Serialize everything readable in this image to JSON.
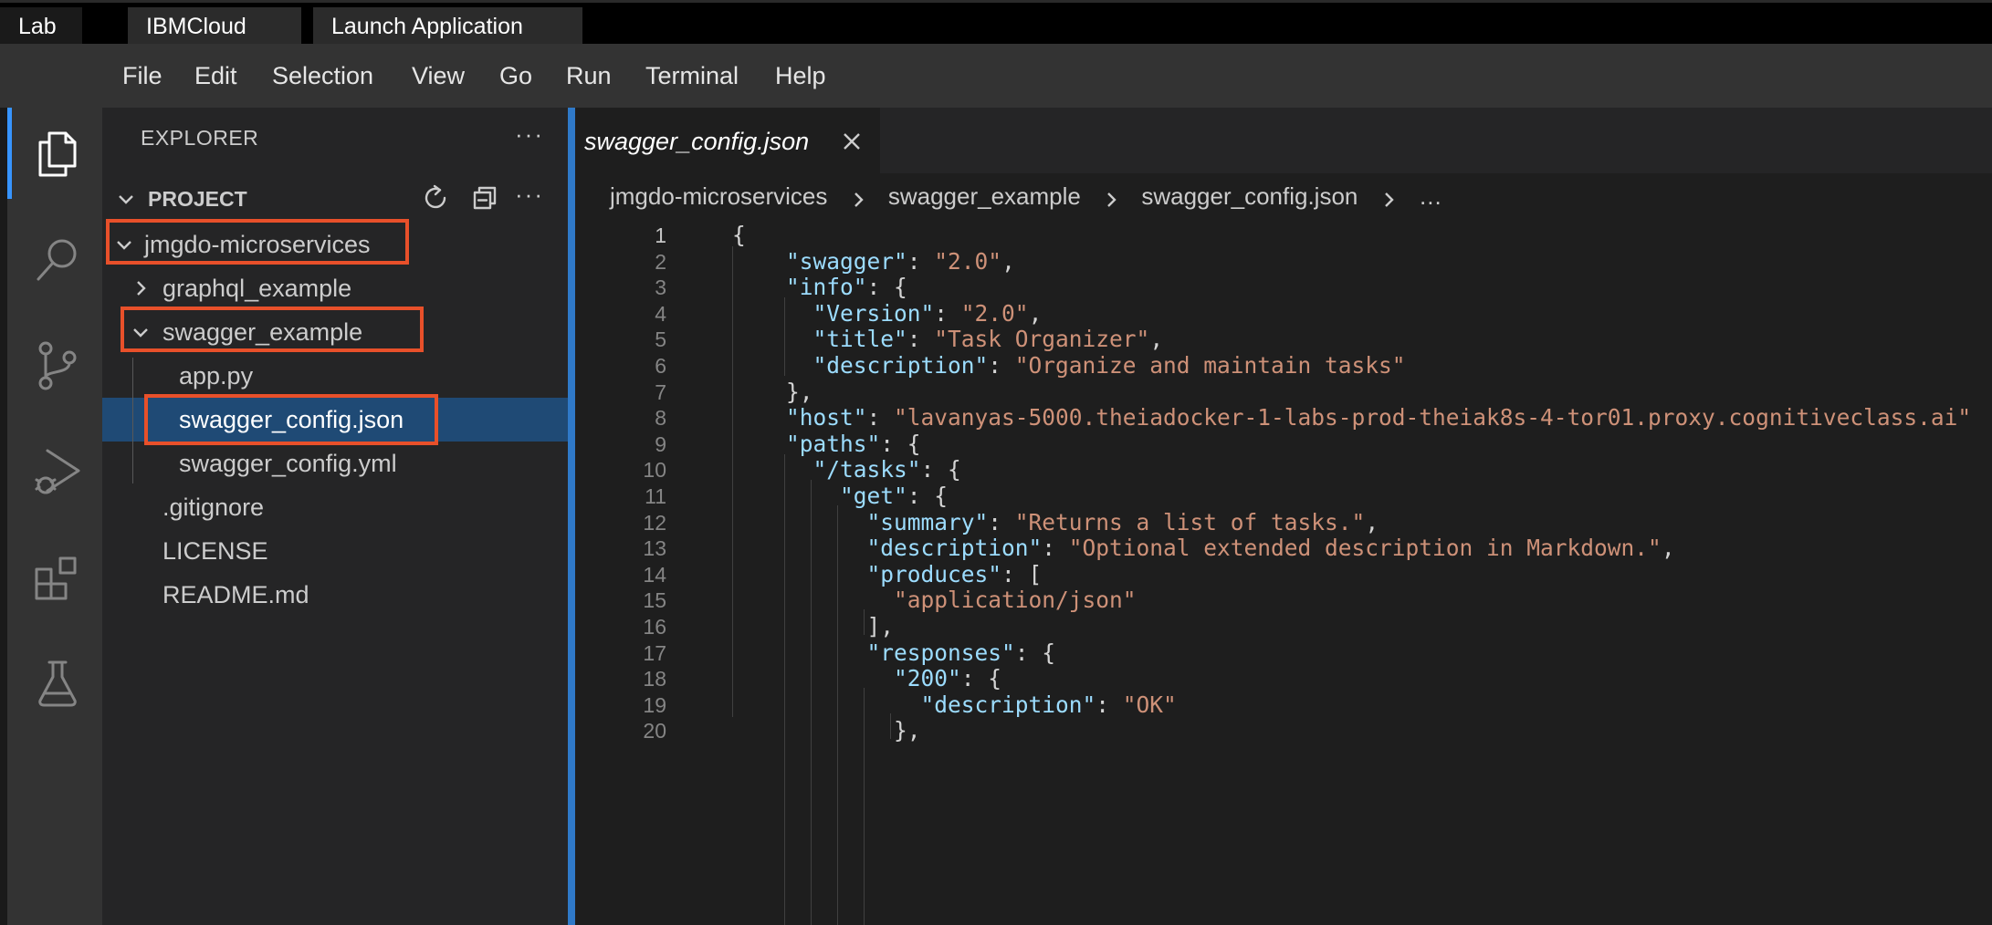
{
  "browser_tabs": [
    "Lab",
    "IBMCloud",
    "Launch Application"
  ],
  "menu": [
    "File",
    "Edit",
    "Selection",
    "View",
    "Go",
    "Run",
    "Terminal",
    "Help"
  ],
  "activity_bar": [
    "explorer-icon",
    "search-icon",
    "source-control-icon",
    "run-debug-icon",
    "extensions-icon",
    "testing-icon"
  ],
  "sidebar": {
    "title": "EXPLORER",
    "more": "···",
    "section": "PROJECT",
    "tree": [
      {
        "label": "jmgdo-microservices",
        "type": "folder",
        "expanded": true
      },
      {
        "label": "graphql_example",
        "type": "folder",
        "expanded": false
      },
      {
        "label": "swagger_example",
        "type": "folder",
        "expanded": true
      },
      {
        "label": "app.py",
        "type": "file"
      },
      {
        "label": "swagger_config.json",
        "type": "file",
        "selected": true
      },
      {
        "label": "swagger_config.yml",
        "type": "file"
      },
      {
        "label": ".gitignore",
        "type": "file"
      },
      {
        "label": "LICENSE",
        "type": "file"
      },
      {
        "label": "README.md",
        "type": "file"
      }
    ]
  },
  "editor": {
    "tab_label": "swagger_config.json",
    "breadcrumb": [
      "jmgdo-microservices",
      "swagger_example",
      "swagger_config.json",
      "…"
    ],
    "lines": [
      [
        [
          "p",
          "{"
        ]
      ],
      [
        [
          "p",
          "    "
        ],
        [
          "k",
          "\"swagger\""
        ],
        [
          "p",
          ": "
        ],
        [
          "s",
          "\"2.0\""
        ],
        [
          "p",
          ","
        ]
      ],
      [
        [
          "p",
          "    "
        ],
        [
          "k",
          "\"info\""
        ],
        [
          "p",
          ": {"
        ]
      ],
      [
        [
          "p",
          "      "
        ],
        [
          "k",
          "\"Version\""
        ],
        [
          "p",
          ": "
        ],
        [
          "s",
          "\"2.0\""
        ],
        [
          "p",
          ","
        ]
      ],
      [
        [
          "p",
          "      "
        ],
        [
          "k",
          "\"title\""
        ],
        [
          "p",
          ": "
        ],
        [
          "s",
          "\"Task Organizer\""
        ],
        [
          "p",
          ","
        ]
      ],
      [
        [
          "p",
          "      "
        ],
        [
          "k",
          "\"description\""
        ],
        [
          "p",
          ": "
        ],
        [
          "s",
          "\"Organize and maintain tasks\""
        ]
      ],
      [
        [
          "p",
          "    },"
        ]
      ],
      [
        [
          "p",
          "    "
        ],
        [
          "k",
          "\"host\""
        ],
        [
          "p",
          ": "
        ],
        [
          "s",
          "\"lavanyas-5000.theiadocker-1-labs-prod-theiak8s-4-tor01.proxy.cognitiveclass.ai\""
        ]
      ],
      [
        [
          "p",
          "    "
        ],
        [
          "k",
          "\"paths\""
        ],
        [
          "p",
          ": {"
        ]
      ],
      [
        [
          "p",
          "      "
        ],
        [
          "k",
          "\"/tasks\""
        ],
        [
          "p",
          ": {"
        ]
      ],
      [
        [
          "p",
          "        "
        ],
        [
          "k",
          "\"get\""
        ],
        [
          "p",
          ": {"
        ]
      ],
      [
        [
          "p",
          "          "
        ],
        [
          "k",
          "\"summary\""
        ],
        [
          "p",
          ": "
        ],
        [
          "s",
          "\"Returns a list of tasks.\""
        ],
        [
          "p",
          ","
        ]
      ],
      [
        [
          "p",
          "          "
        ],
        [
          "k",
          "\"description\""
        ],
        [
          "p",
          ": "
        ],
        [
          "s",
          "\"Optional extended description in Markdown.\""
        ],
        [
          "p",
          ","
        ]
      ],
      [
        [
          "p",
          "          "
        ],
        [
          "k",
          "\"produces\""
        ],
        [
          "p",
          ": ["
        ]
      ],
      [
        [
          "p",
          "            "
        ],
        [
          "s",
          "\"application/json\""
        ]
      ],
      [
        [
          "p",
          "          ],"
        ]
      ],
      [
        [
          "p",
          "          "
        ],
        [
          "k",
          "\"responses\""
        ],
        [
          "p",
          ": {"
        ]
      ],
      [
        [
          "p",
          "            "
        ],
        [
          "k",
          "\"200\""
        ],
        [
          "p",
          ": {"
        ]
      ],
      [
        [
          "p",
          "              "
        ],
        [
          "k",
          "\"description\""
        ],
        [
          "p",
          ": "
        ],
        [
          "s",
          "\"OK\""
        ]
      ],
      [
        [
          "p",
          "            },"
        ]
      ]
    ],
    "current_line": 1
  },
  "colors": {
    "accent": "#3794ff",
    "highlight_box": "#e8502a",
    "selection": "#1f4a75",
    "json_key": "#9cdcfe",
    "json_string": "#ce9178"
  }
}
